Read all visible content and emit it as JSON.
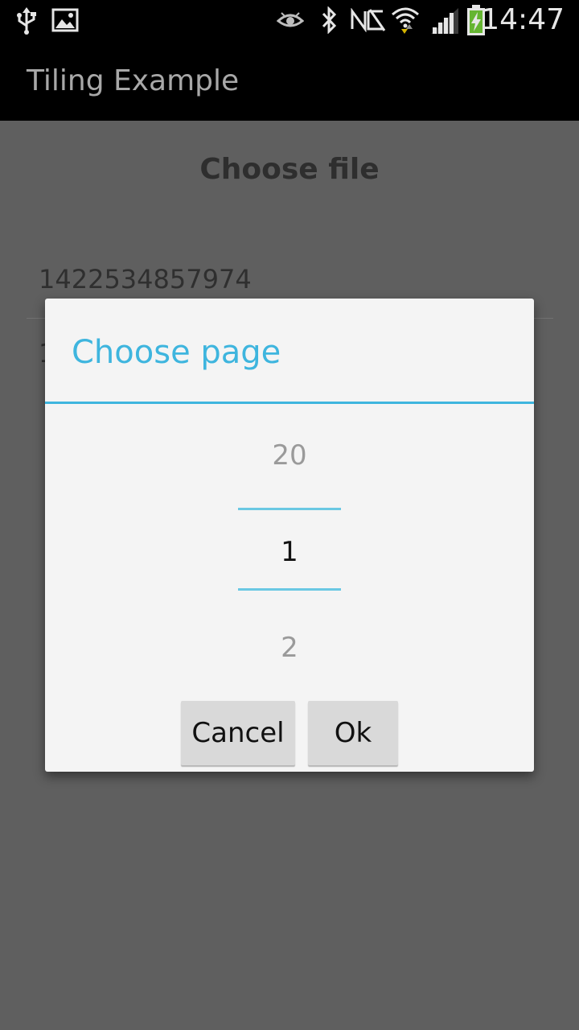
{
  "status_bar": {
    "time": "14:47",
    "icons": [
      "usb-icon",
      "image-notification-icon",
      "eye-icon",
      "bluetooth-icon",
      "nfc-icon",
      "wifi-icon",
      "signal-icon",
      "battery-charging-icon"
    ]
  },
  "app": {
    "title": "Tiling Example"
  },
  "background": {
    "heading": "Choose file",
    "files": [
      "1422534857974",
      "1"
    ]
  },
  "dialog": {
    "title": "Choose page",
    "picker": {
      "previous": "20",
      "current": "1",
      "next": "2"
    },
    "cancel_label": "Cancel",
    "ok_label": "Ok"
  },
  "colors": {
    "accent": "#3eb5de",
    "dim_background": "#5f5f5f",
    "dialog_background": "#f4f4f4",
    "button_background": "#d9d9d9"
  }
}
